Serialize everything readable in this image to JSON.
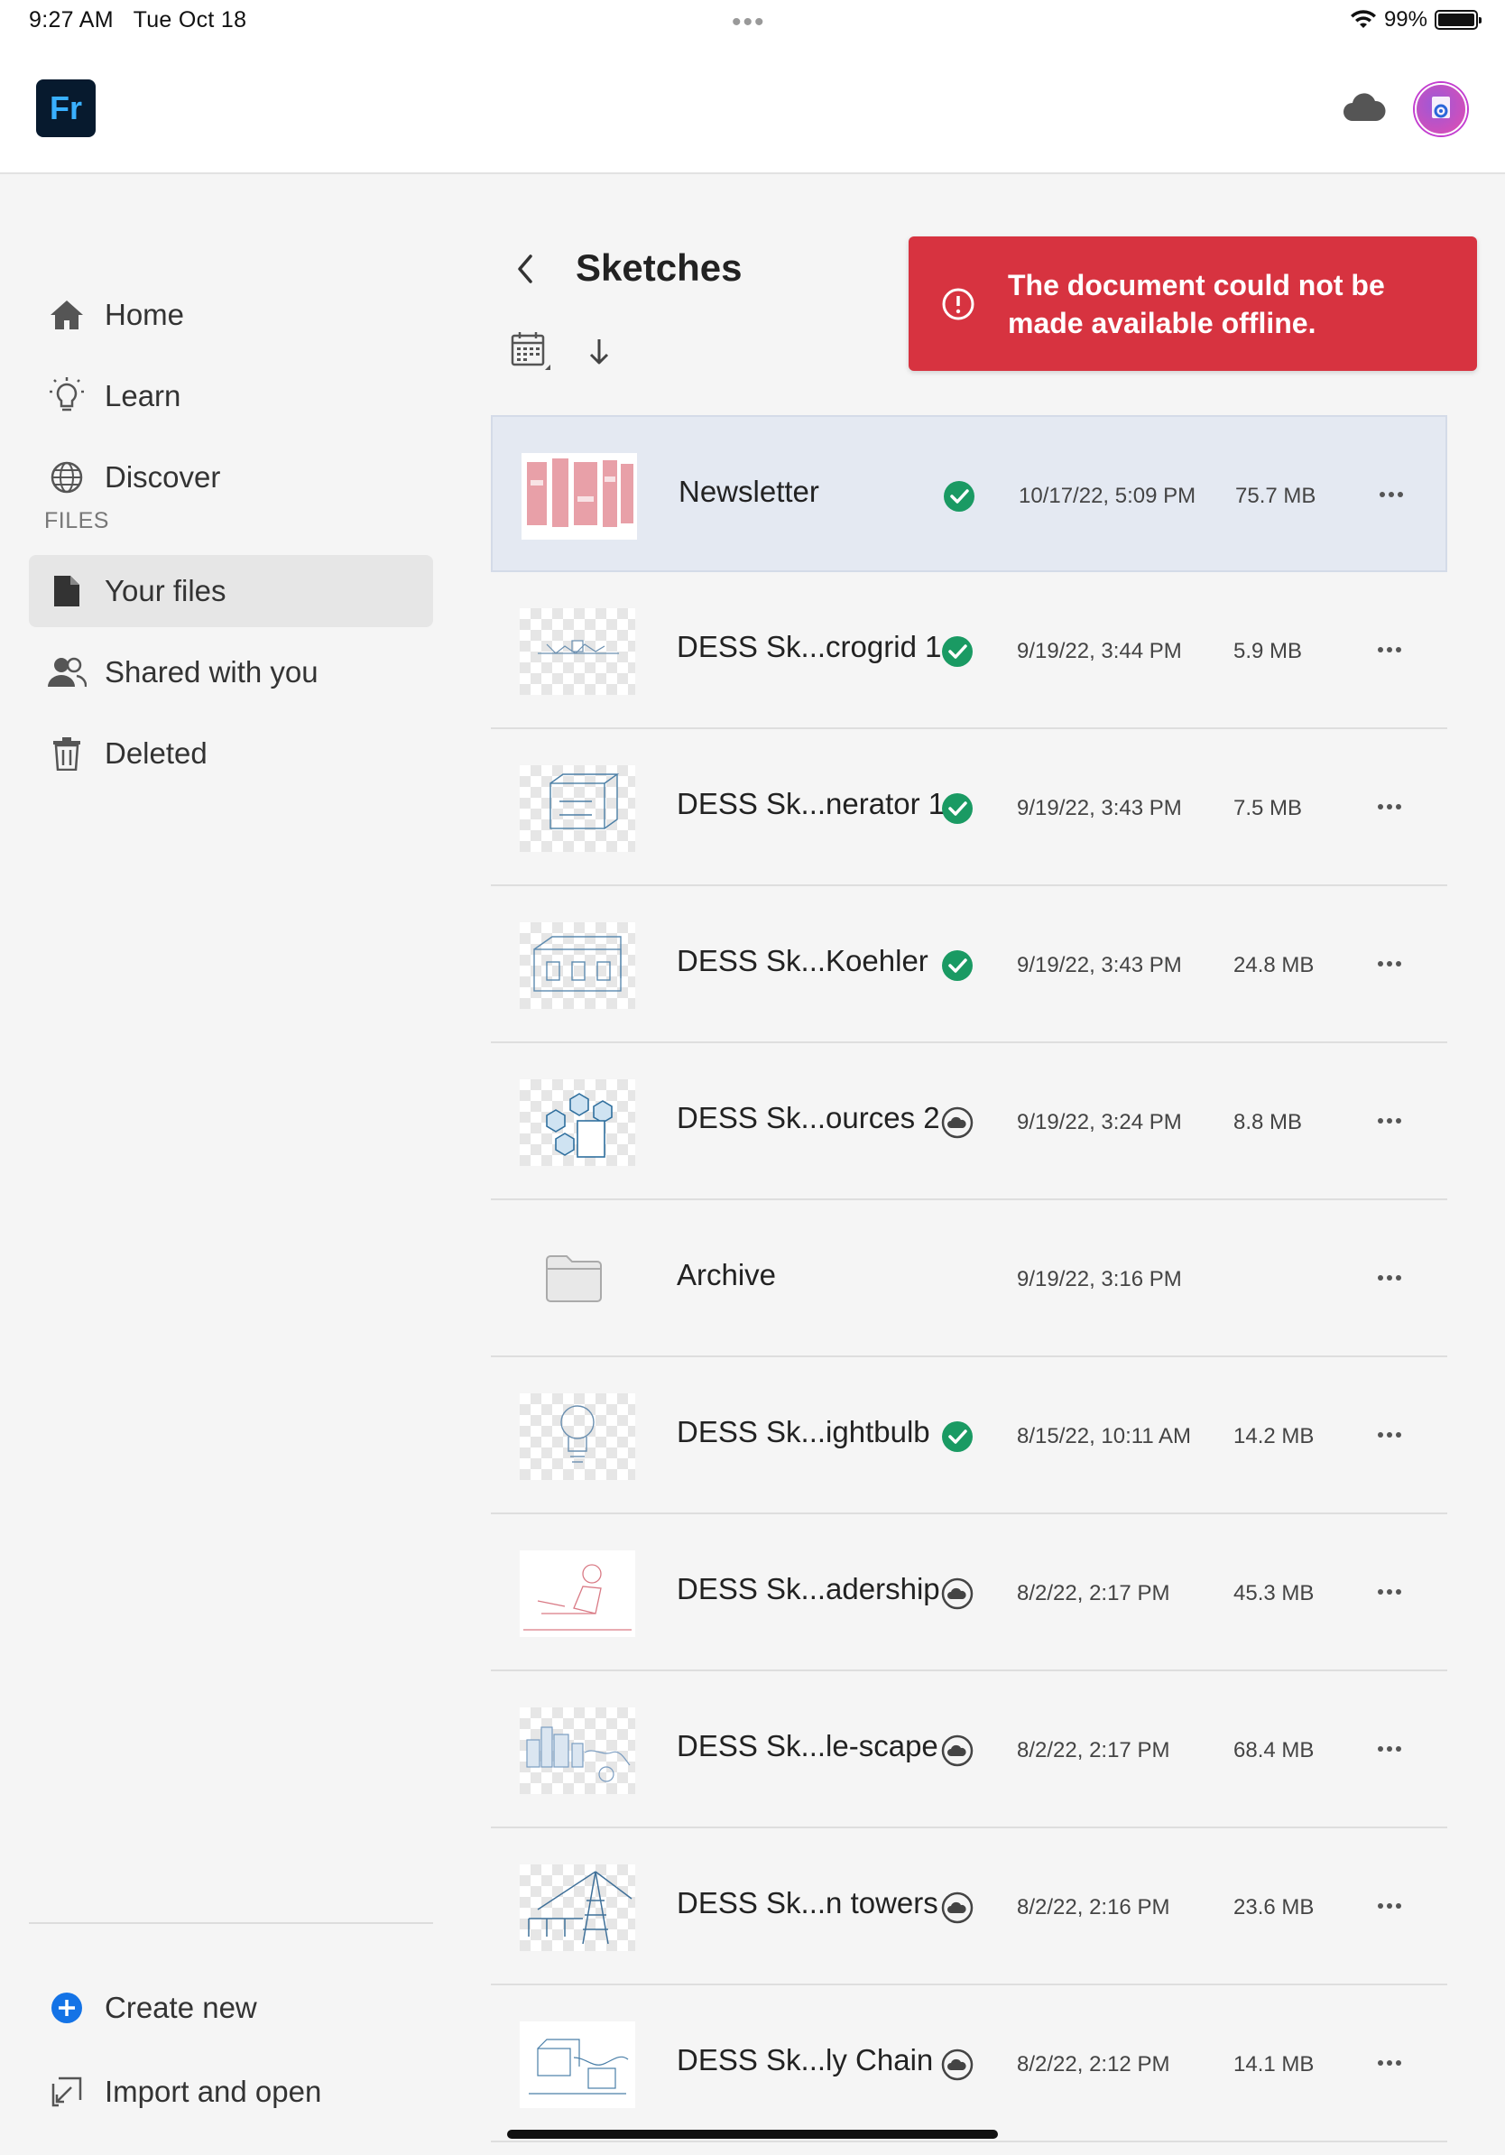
{
  "status_bar": {
    "time": "9:27 AM",
    "date": "Tue Oct 18",
    "battery": "99%"
  },
  "app": {
    "logo_text": "Fr",
    "accent": "#39b0ff"
  },
  "sidebar": {
    "items": [
      {
        "label": "Home",
        "icon": "home-icon"
      },
      {
        "label": "Learn",
        "icon": "lightbulb-icon"
      },
      {
        "label": "Discover",
        "icon": "globe-icon"
      }
    ],
    "files_header": "FILES",
    "file_items": [
      {
        "label": "Your files",
        "icon": "document-icon",
        "active": true
      },
      {
        "label": "Shared with you",
        "icon": "people-icon"
      },
      {
        "label": "Deleted",
        "icon": "trash-icon"
      }
    ],
    "bottom_items": [
      {
        "label": "Create new",
        "icon": "plus-circle-icon"
      },
      {
        "label": "Import and open",
        "icon": "import-icon"
      }
    ]
  },
  "content": {
    "title": "Sketches",
    "toast": {
      "message": "The document could not be made available offline.",
      "color": "#d73340"
    },
    "files": [
      {
        "name": "Newsletter",
        "status": "synced",
        "date": "10/17/22, 5:09 PM",
        "size": "75.7 MB",
        "selected": true
      },
      {
        "name": "DESS Sk...crogrid 1",
        "status": "synced",
        "date": "9/19/22, 3:44 PM",
        "size": "5.9 MB"
      },
      {
        "name": "DESS Sk...nerator 1",
        "status": "synced",
        "date": "9/19/22, 3:43 PM",
        "size": "7.5 MB"
      },
      {
        "name": "DESS Sk...Koehler",
        "status": "synced",
        "date": "9/19/22, 3:43 PM",
        "size": "24.8 MB"
      },
      {
        "name": "DESS Sk...ources 2",
        "status": "cloud",
        "date": "9/19/22, 3:24 PM",
        "size": "8.8 MB"
      },
      {
        "name": "Archive",
        "status": "folder",
        "date": "9/19/22, 3:16 PM",
        "size": ""
      },
      {
        "name": "DESS Sk...ightbulb",
        "status": "synced",
        "date": "8/15/22, 10:11 AM",
        "size": "14.2 MB"
      },
      {
        "name": "DESS Sk...adership",
        "status": "cloud",
        "date": "8/2/22, 2:17 PM",
        "size": "45.3 MB"
      },
      {
        "name": "DESS Sk...le-scape",
        "status": "cloud",
        "date": "8/2/22, 2:17 PM",
        "size": "68.4 MB"
      },
      {
        "name": "DESS Sk...n towers",
        "status": "cloud",
        "date": "8/2/22, 2:16 PM",
        "size": "23.6 MB"
      },
      {
        "name": "DESS Sk...ly Chain",
        "status": "cloud",
        "date": "8/2/22, 2:12 PM",
        "size": "14.1 MB"
      }
    ]
  }
}
